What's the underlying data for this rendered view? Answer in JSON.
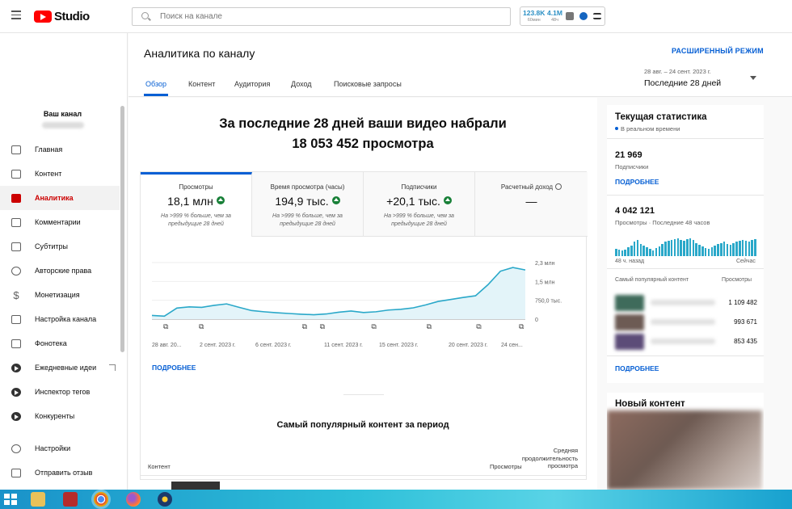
{
  "header": {
    "app_name": "Studio",
    "search_placeholder": "Поиск на канале",
    "ext_stats": [
      {
        "value": "123.8K",
        "label": "60мин"
      },
      {
        "value": "4.1M",
        "label": "48ч"
      }
    ]
  },
  "sidebar": {
    "channel_title": "Ваш канал",
    "items": [
      {
        "label": "Главная",
        "icon": "dashboard-icon"
      },
      {
        "label": "Контент",
        "icon": "content-icon"
      },
      {
        "label": "Аналитика",
        "icon": "analytics-icon",
        "active": true
      },
      {
        "label": "Комментарии",
        "icon": "comments-icon"
      },
      {
        "label": "Субтитры",
        "icon": "subtitles-icon"
      },
      {
        "label": "Авторские права",
        "icon": "copyright-icon"
      },
      {
        "label": "Монетизация",
        "icon": "dollar-icon"
      },
      {
        "label": "Настройка канала",
        "icon": "wand-icon"
      },
      {
        "label": "Фонотека",
        "icon": "audio-library-icon"
      },
      {
        "label": "Ежедневные идеи",
        "icon": "vidiq-icon"
      },
      {
        "label": "Инспектор тегов",
        "icon": "vidiq-icon"
      },
      {
        "label": "Конкуренты",
        "icon": "vidiq-icon"
      }
    ],
    "bottom_items": [
      {
        "label": "Настройки",
        "icon": "gear-icon"
      },
      {
        "label": "Отправить отзыв",
        "icon": "feedback-icon"
      }
    ]
  },
  "main": {
    "title": "Аналитика по каналу",
    "advanced_mode": "РАСШИРЕННЫЙ РЕЖИМ",
    "tabs": [
      "Обзор",
      "Контент",
      "Аудитория",
      "Доход",
      "Поисковые запросы"
    ],
    "date_range": "28 авг. – 24 сент. 2023 г.",
    "date_period": "Последние 28 дней",
    "headline_line1": "За последние 28 дней ваши видео набрали",
    "headline_line2": "18 053 452 просмотра",
    "cards": [
      {
        "title": "Просмотры",
        "value": "18,1 млн",
        "note": "На >999 % больше, чем за предыдущие 28 дней"
      },
      {
        "title": "Время просмотра (часы)",
        "value": "194,9 тыс.",
        "note": "На >999 % больше, чем за предыдущие 28 дней"
      },
      {
        "title": "Подписчики",
        "value": "+20,1 тыс.",
        "note": "На >999 % больше, чем за предыдущие 28 дней"
      },
      {
        "title": "Расчетный доход",
        "value": "—",
        "note": ""
      }
    ],
    "more_link": "ПОДРОБНЕЕ",
    "popular_title": "Самый популярный контент за период",
    "table_headers": {
      "content": "Контент",
      "views": "Просмотры",
      "avg1": "Средняя",
      "avg2": "продолжительность",
      "avg3": "просмотра"
    }
  },
  "chart_data": {
    "type": "area",
    "x_tick_labels": [
      "28 авг. 20...",
      "2 сент. 2023 г.",
      "6 сент. 2023 г.",
      "11 сент. 2023 г.",
      "15 сент. 2023 г.",
      "20 сент. 2023 г.",
      "24 сен..."
    ],
    "y_tick_labels": [
      "2,3 млн",
      "1,5 млн",
      "750,0 тыс.",
      "0"
    ],
    "ylim": [
      0,
      2300000
    ],
    "series": [
      {
        "values": [
          150000,
          120000,
          450000,
          500000,
          480000,
          560000,
          620000,
          480000,
          350000,
          300000,
          260000,
          230000,
          200000,
          180000,
          210000,
          280000,
          330000,
          270000,
          300000,
          370000,
          400000,
          460000,
          580000,
          720000,
          800000,
          880000,
          950000,
          1400000,
          1950000,
          2100000,
          2000000
        ]
      }
    ],
    "markers_count": 8,
    "color": "#2aa8c9"
  },
  "realtime": {
    "title": "Текущая статистика",
    "subtitle": "В реальном времени",
    "subs_value": "21 969",
    "subs_label": "Подписчики",
    "more": "ПОДРОБНЕЕ",
    "views_value": "4 042 121",
    "views_label": "Просмотры · Последние 48 часов",
    "axis_left": "48 ч. назад",
    "axis_right": "Сейчас",
    "top_header_left": "Самый популярный контент",
    "top_header_right": "Просмотры",
    "top_rows": [
      "1 109 482",
      "993 671",
      "853 435"
    ],
    "more2": "ПОДРОБНЕЕ",
    "hourly_bars": [
      8,
      7,
      6,
      7,
      10,
      12,
      16,
      18,
      14,
      12,
      10,
      8,
      6,
      9,
      11,
      14,
      16,
      17,
      18,
      19,
      20,
      18,
      17,
      19,
      20,
      18,
      15,
      13,
      11,
      9,
      8,
      10,
      12,
      14,
      15,
      16,
      14,
      13,
      15,
      16,
      17,
      18,
      17,
      16,
      18,
      19
    ]
  },
  "new_content": {
    "title": "Новый контент"
  }
}
